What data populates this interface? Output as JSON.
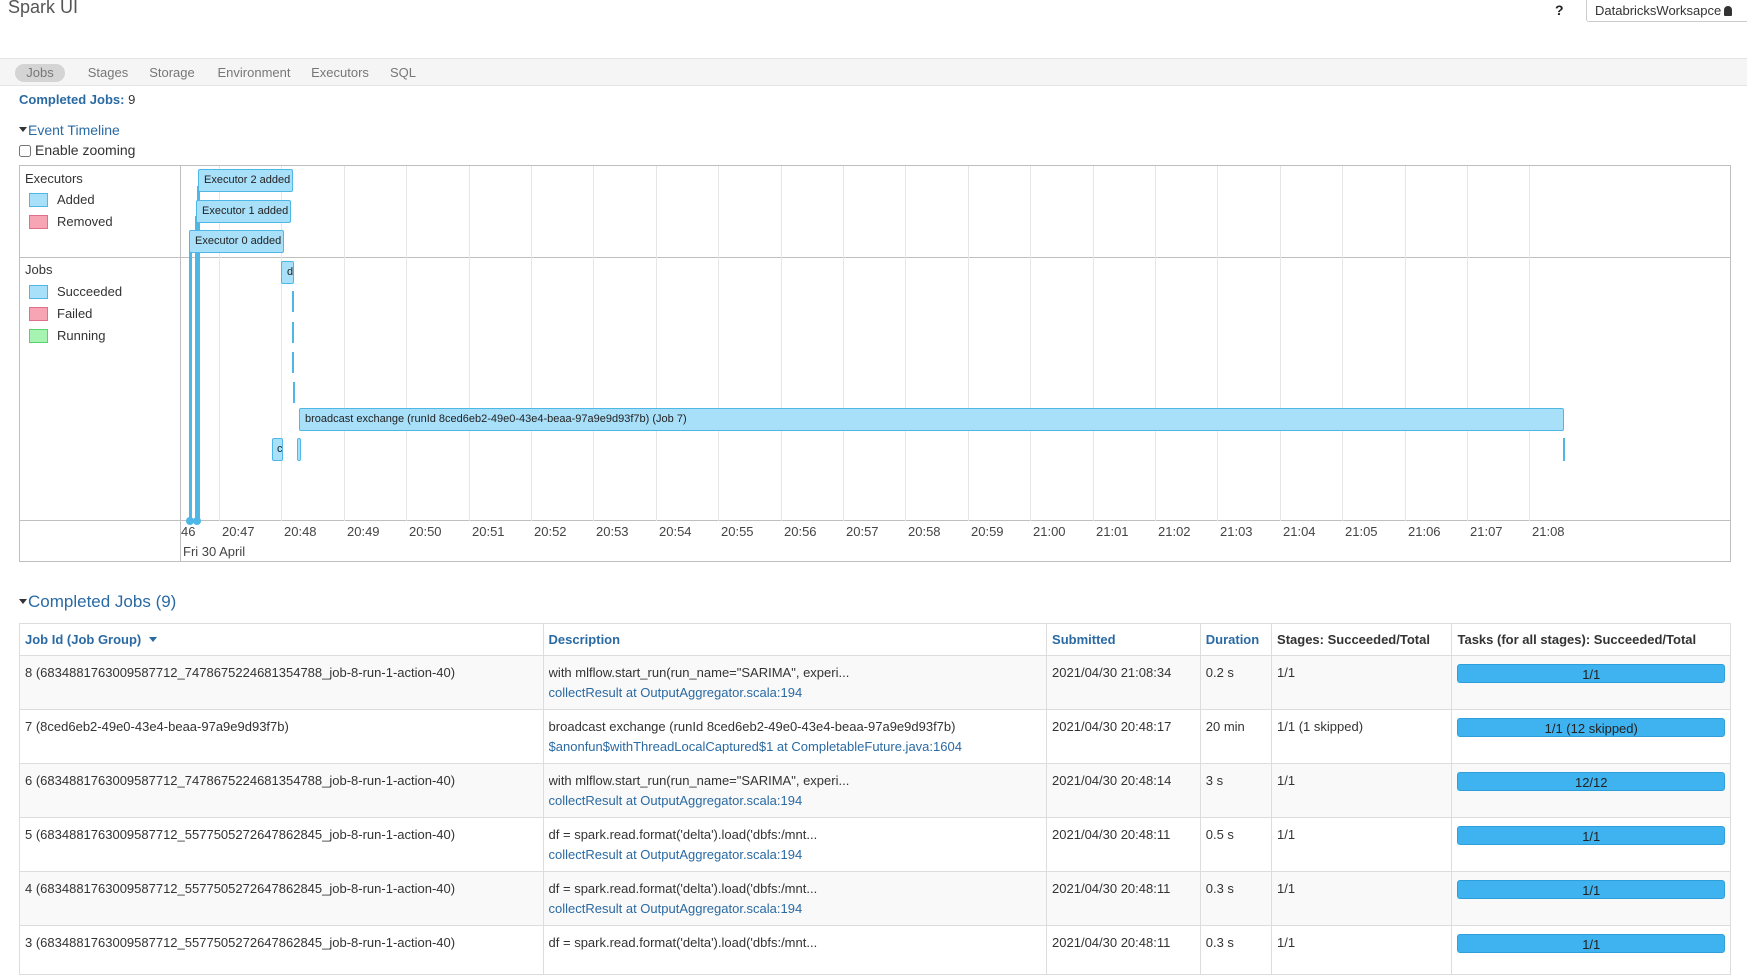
{
  "app": {
    "title": "Spark UI",
    "help": "?",
    "workspace": "DatabricksWorksapce"
  },
  "nav": {
    "tabs": [
      "Jobs",
      "Stages",
      "Storage",
      "Environment",
      "Executors",
      "SQL"
    ],
    "active": "Jobs"
  },
  "summary": {
    "label": "Completed Jobs:",
    "value": "9"
  },
  "timeline": {
    "toggle_label": "Event Timeline",
    "zoom_label": "Enable zooming",
    "executors_title": "Executors",
    "executor_legend": [
      {
        "label": "Added",
        "color": "#a8dff9"
      },
      {
        "label": "Removed",
        "color": "#f7a5b4"
      }
    ],
    "jobs_title": "Jobs",
    "job_legend": [
      {
        "label": "Succeeded",
        "color": "#a8dff9"
      },
      {
        "label": "Failed",
        "color": "#f7a5b4"
      },
      {
        "label": "Running",
        "color": "#a6f3b2"
      }
    ],
    "executor_events": [
      "Executor 2 added",
      "Executor 1 added",
      "Executor 0 added"
    ],
    "job_bar_label": "broadcast exchange (runId 8ced6eb2-49e0-43e4-beaa-97a9e9d93f7b) (Job 7)",
    "small_job_labels": [
      "d",
      "c"
    ],
    "first_tick": "46",
    "ticks": [
      "20:47",
      "20:48",
      "20:49",
      "20:50",
      "20:51",
      "20:52",
      "20:53",
      "20:54",
      "20:55",
      "20:56",
      "20:57",
      "20:58",
      "20:59",
      "21:00",
      "21:01",
      "21:02",
      "21:03",
      "21:04",
      "21:05",
      "21:06",
      "21:07",
      "21:08"
    ],
    "date": "Fri 30 April"
  },
  "jobs_section": {
    "toggle_label": "Completed Jobs (9)",
    "headers": {
      "job_id": "Job Id (Job Group)",
      "description": "Description",
      "submitted": "Submitted",
      "duration": "Duration",
      "stages": "Stages: Succeeded/Total",
      "tasks": "Tasks (for all stages): Succeeded/Total"
    },
    "rows": [
      {
        "id": "8 (6834881763009587712_7478675224681354788_job-8-run-1-action-40)",
        "desc": "with mlflow.start_run(run_name=\"SARIMA\", experi...",
        "link": "collectResult at OutputAggregator.scala:194",
        "submitted": "2021/04/30 21:08:34",
        "duration": "0.2 s",
        "stages": "1/1",
        "tasks": "1/1"
      },
      {
        "id": "7 (8ced6eb2-49e0-43e4-beaa-97a9e9d93f7b)",
        "desc": "broadcast exchange (runId 8ced6eb2-49e0-43e4-beaa-97a9e9d93f7b)",
        "link": "$anonfun$withThreadLocalCaptured$1 at CompletableFuture.java:1604",
        "submitted": "2021/04/30 20:48:17",
        "duration": "20 min",
        "stages": "1/1 (1 skipped)",
        "tasks": "1/1 (12 skipped)"
      },
      {
        "id": "6 (6834881763009587712_7478675224681354788_job-8-run-1-action-40)",
        "desc": "with mlflow.start_run(run_name=\"SARIMA\", experi...",
        "link": "collectResult at OutputAggregator.scala:194",
        "submitted": "2021/04/30 20:48:14",
        "duration": "3 s",
        "stages": "1/1",
        "tasks": "12/12"
      },
      {
        "id": "5 (6834881763009587712_5577505272647862845_job-8-run-1-action-40)",
        "desc": "df = spark.read.format('delta').load('dbfs:/mnt...",
        "link": "collectResult at OutputAggregator.scala:194",
        "submitted": "2021/04/30 20:48:11",
        "duration": "0.5 s",
        "stages": "1/1",
        "tasks": "1/1"
      },
      {
        "id": "4 (6834881763009587712_5577505272647862845_job-8-run-1-action-40)",
        "desc": "df = spark.read.format('delta').load('dbfs:/mnt...",
        "link": "collectResult at OutputAggregator.scala:194",
        "submitted": "2021/04/30 20:48:11",
        "duration": "0.3 s",
        "stages": "1/1",
        "tasks": "1/1"
      },
      {
        "id": "3 (6834881763009587712_5577505272647862845_job-8-run-1-action-40)",
        "desc": "df = spark.read.format('delta').load('dbfs:/mnt...",
        "link": "",
        "submitted": "2021/04/30 20:48:11",
        "duration": "0.3 s",
        "stages": "1/1",
        "tasks": "1/1"
      }
    ]
  }
}
